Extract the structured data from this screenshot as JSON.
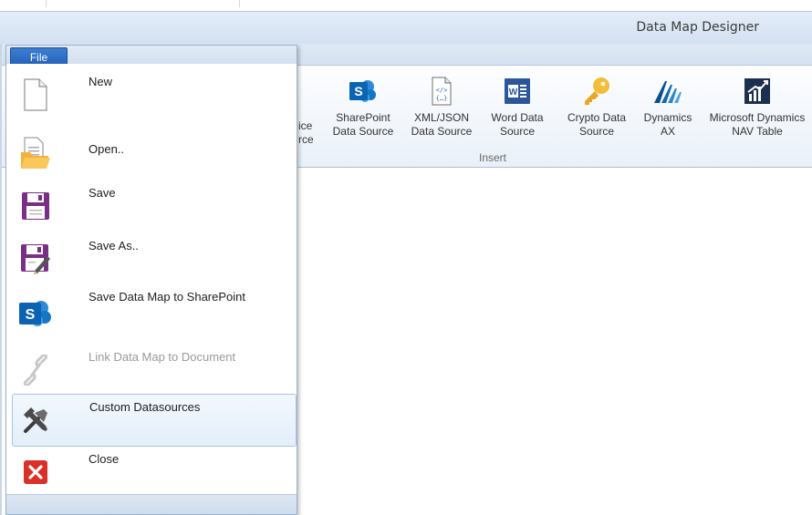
{
  "window": {
    "title": "Data Map Designer"
  },
  "file_menu": {
    "tab_label": "File",
    "items": [
      {
        "label": "New",
        "icon": "new-document-icon",
        "enabled": true
      },
      {
        "label": "Open..",
        "icon": "open-folder-icon",
        "enabled": true
      },
      {
        "label": "Save",
        "icon": "save-icon",
        "enabled": true
      },
      {
        "label": "Save As..",
        "icon": "save-as-icon",
        "enabled": true
      },
      {
        "label": "Save Data Map to SharePoint",
        "icon": "sharepoint-icon",
        "enabled": true
      },
      {
        "label": "Link Data Map to Document",
        "icon": "link-icon",
        "enabled": false
      },
      {
        "label": "Custom Datasources",
        "icon": "tools-icon",
        "enabled": true,
        "highlighted": true
      },
      {
        "label": "Close",
        "icon": "close-icon",
        "enabled": true
      }
    ]
  },
  "ribbon": {
    "partial_label": "ice\nrce",
    "group_label": "Insert",
    "buttons": [
      {
        "label": "SharePoint\nData Source",
        "icon": "sharepoint-icon"
      },
      {
        "label": "XML/JSON\nData Source",
        "icon": "xml-json-file-icon"
      },
      {
        "label": "Word Data\nSource",
        "icon": "word-icon"
      },
      {
        "label": "Crypto Data\nSource",
        "icon": "key-icon"
      },
      {
        "label": "Dynamics\nAX",
        "icon": "dynamics-ax-icon"
      },
      {
        "label": "Microsoft Dynamics\nNAV Table",
        "icon": "dynamics-nav-icon"
      }
    ]
  },
  "colors": {
    "file_tab": "#2a6bc4",
    "sharepoint": "#0d6fbf",
    "word": "#2b579a",
    "save": "#7a2f86",
    "close": "#d9312a",
    "key": "#f1b52a"
  }
}
